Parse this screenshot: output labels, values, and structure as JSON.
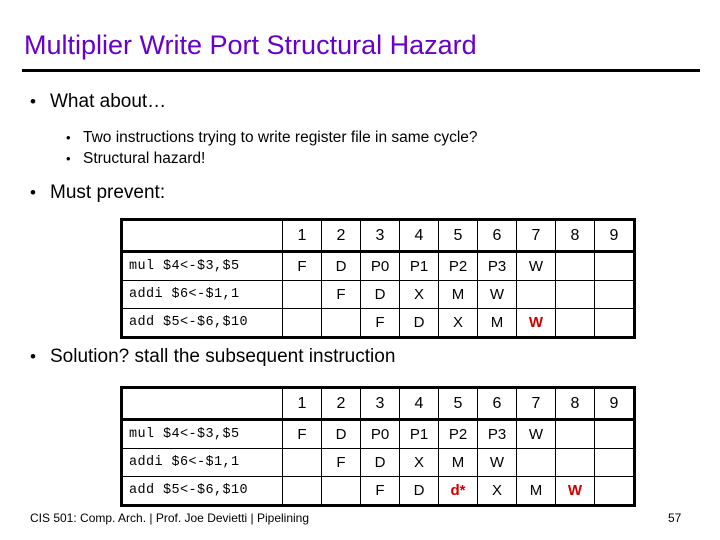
{
  "slide": {
    "title": "Multiplier Write Port Structural Hazard",
    "accent_color": "#6600CC",
    "highlight_color": "#CC0000",
    "bullet_glyph": "•"
  },
  "bullets": {
    "what_about": "What about…",
    "two_instructions": "Two instructions trying to write register file in same cycle?",
    "structural_hazard": "Structural hazard!",
    "must_prevent": "Must prevent:",
    "solution": "Solution? stall the subsequent instruction"
  },
  "tables": {
    "must_prevent": {
      "corner_header": "",
      "cycles": [
        "1",
        "2",
        "3",
        "4",
        "5",
        "6",
        "7",
        "8",
        "9"
      ],
      "rows": [
        {
          "instruction": "mul $4<-$3,$5",
          "stages": [
            "F",
            "D",
            "P0",
            "P1",
            "P2",
            "P3",
            "W",
            "",
            ""
          ],
          "highlight": [
            false,
            false,
            false,
            false,
            false,
            false,
            false,
            false,
            false
          ]
        },
        {
          "instruction": "addi $6<-$1,1",
          "stages": [
            "",
            "F",
            "D",
            "X",
            "M",
            "W",
            "",
            "",
            ""
          ],
          "highlight": [
            false,
            false,
            false,
            false,
            false,
            false,
            false,
            false,
            false
          ]
        },
        {
          "instruction": "add $5<-$6,$10",
          "stages": [
            "",
            "",
            "F",
            "D",
            "X",
            "M",
            "W",
            "",
            ""
          ],
          "highlight": [
            false,
            false,
            false,
            false,
            false,
            false,
            true,
            false,
            false
          ]
        }
      ]
    },
    "solution": {
      "corner_header": "",
      "cycles": [
        "1",
        "2",
        "3",
        "4",
        "5",
        "6",
        "7",
        "8",
        "9"
      ],
      "rows": [
        {
          "instruction": "mul $4<-$3,$5",
          "stages": [
            "F",
            "D",
            "P0",
            "P1",
            "P2",
            "P3",
            "W",
            "",
            ""
          ],
          "highlight": [
            false,
            false,
            false,
            false,
            false,
            false,
            false,
            false,
            false
          ]
        },
        {
          "instruction": "addi $6<-$1,1",
          "stages": [
            "",
            "F",
            "D",
            "X",
            "M",
            "W",
            "",
            "",
            ""
          ],
          "highlight": [
            false,
            false,
            false,
            false,
            false,
            false,
            false,
            false,
            false
          ]
        },
        {
          "instruction": "add $5<-$6,$10",
          "stages": [
            "",
            "",
            "F",
            "D",
            "d*",
            "X",
            "M",
            "W",
            ""
          ],
          "highlight": [
            false,
            false,
            false,
            false,
            true,
            false,
            false,
            true,
            false
          ]
        }
      ]
    }
  },
  "footer": {
    "text": "CIS 501: Comp. Arch.  |  Prof. Joe Devietti  |  Pipelining",
    "page_number": "57"
  }
}
